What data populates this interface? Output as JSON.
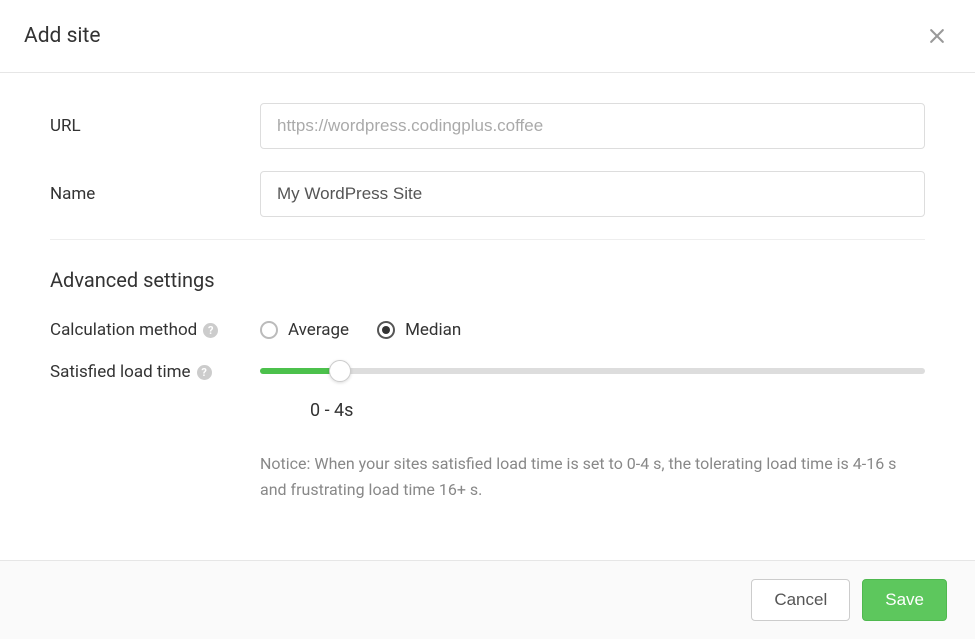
{
  "header": {
    "title": "Add site"
  },
  "form": {
    "url": {
      "label": "URL",
      "placeholder": "https://wordpress.codingplus.coffee",
      "value": ""
    },
    "name": {
      "label": "Name",
      "value": "My WordPress Site"
    }
  },
  "advanced": {
    "heading": "Advanced settings",
    "calculation": {
      "label": "Calculation method",
      "options": {
        "average": "Average",
        "median": "Median"
      },
      "selected": "median"
    },
    "satisfied": {
      "label": "Satisfied load time",
      "value_display": "0 - 4s",
      "notice": "Notice: When your sites satisfied load time is set to 0-4 s, the tolerating load time is 4-16 s and frustrating load time 16+ s."
    }
  },
  "footer": {
    "cancel": "Cancel",
    "save": "Save"
  },
  "colors": {
    "accent_green": "#5dc75d"
  }
}
